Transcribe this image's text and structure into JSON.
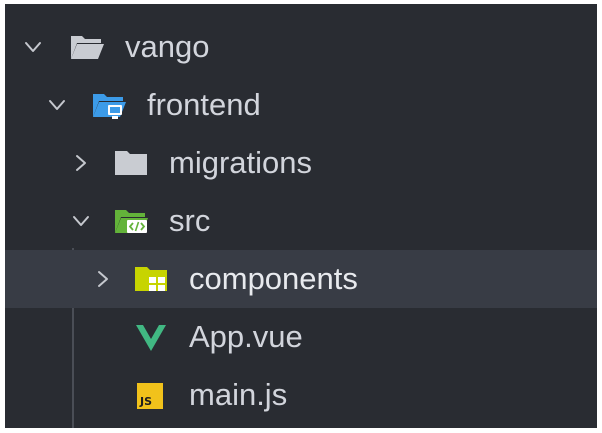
{
  "explorer": {
    "items": [
      {
        "label": "vango",
        "icon": "folder-open-icon",
        "expanded": true,
        "depth": 0
      },
      {
        "label": "frontend",
        "icon": "folder-open-blue-icon",
        "expanded": true,
        "depth": 1
      },
      {
        "label": "migrations",
        "icon": "folder-closed-icon",
        "expanded": false,
        "depth": 2
      },
      {
        "label": "src",
        "icon": "folder-src-green-icon",
        "expanded": true,
        "depth": 2
      },
      {
        "label": "components",
        "icon": "folder-components-yellow-icon",
        "expanded": false,
        "depth": 3,
        "selected": true
      },
      {
        "label": "App.vue",
        "icon": "vue-file-icon",
        "depth": 3
      },
      {
        "label": "main.js",
        "icon": "js-file-icon",
        "depth": 3
      }
    ]
  },
  "colors": {
    "panel_background": "#292c32",
    "selected_row": "#383c45",
    "text": "#d2d5dc",
    "folder_grey": "#c9ccd2",
    "folder_blue": "#3c9be8",
    "folder_green": "#63b33a",
    "folder_yellow": "#c7d400",
    "vue_green": "#41b883",
    "js_yellow": "#f1c21b"
  }
}
